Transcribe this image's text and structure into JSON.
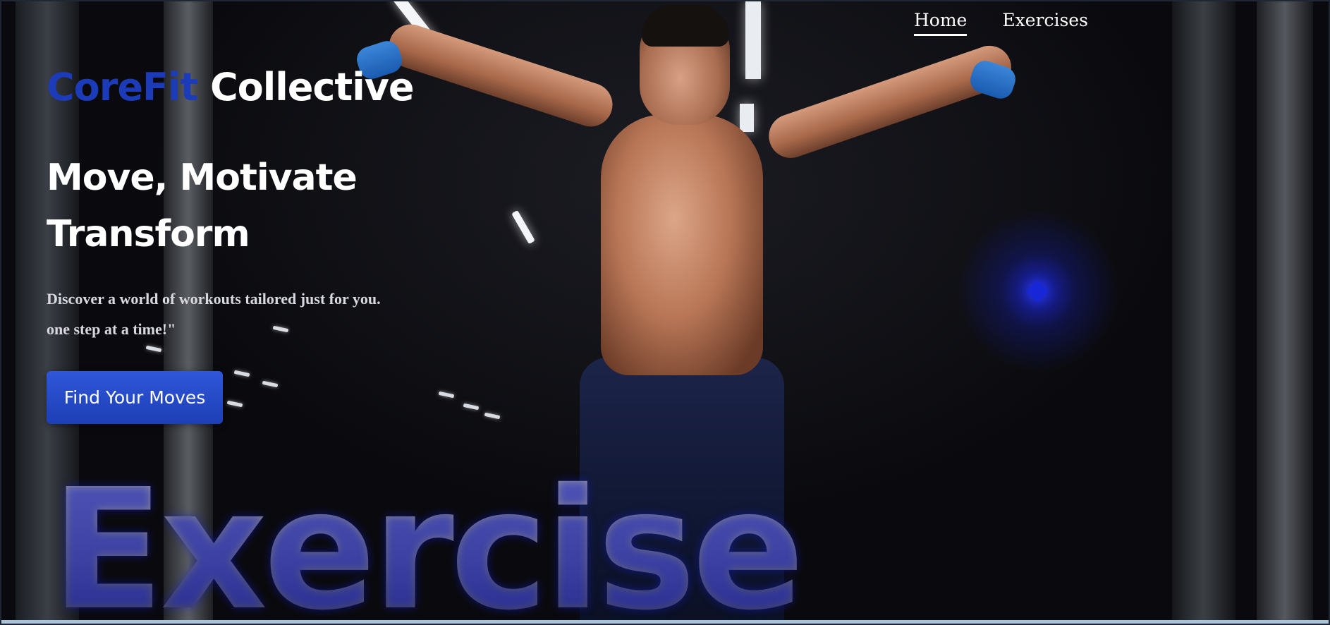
{
  "nav": {
    "items": [
      {
        "label": "Home",
        "active": true
      },
      {
        "label": "Exercises",
        "active": false
      }
    ]
  },
  "hero": {
    "brand_accent": "CoreFit",
    "brand_rest": "Collective",
    "headline_line1": "Move, Motivate",
    "headline_line2": "Transform",
    "tagline_line1": "Discover a world of workouts tailored just for you.",
    "tagline_line2": "one step at a time!\"",
    "cta_label": "Find Your Moves",
    "background_word": "Exercise"
  },
  "colors": {
    "accent_blue": "#1c3bb8",
    "button_blue": "#2f57d9",
    "text_white": "#ffffff",
    "glow_blue": "#1727d8"
  },
  "icons": {
    "background_photo": "gym-athlete-photo",
    "glow": "blue-glow-diamond"
  }
}
